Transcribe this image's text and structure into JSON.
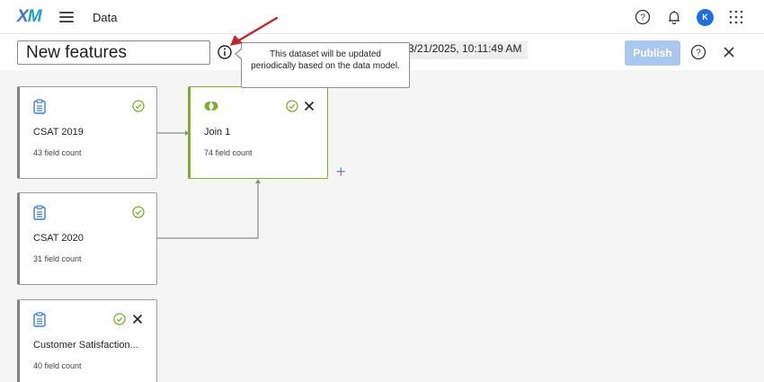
{
  "topbar": {
    "logo": "XM",
    "app_title": "Data",
    "avatar_initial": "K",
    "icons": [
      "hamburger-icon",
      "help-icon",
      "bell-icon",
      "apps-grid-icon"
    ]
  },
  "header": {
    "dataset_name": "New features",
    "timestamp": "3/21/2025, 10:11:49 AM",
    "publish_label": "Publish"
  },
  "tooltip": {
    "text": "This dataset will be updated periodically based on the data model."
  },
  "cards": [
    {
      "title": "CSAT 2019",
      "subtitle": "43 field count",
      "type": "source"
    },
    {
      "title": "Join 1",
      "subtitle": "74 field count",
      "type": "join"
    },
    {
      "title": "CSAT 2020",
      "subtitle": "31 field count",
      "type": "source"
    },
    {
      "title": "Customer Satisfaction...",
      "subtitle": "40 field count",
      "type": "source"
    }
  ],
  "colors": {
    "logo_x": "#3b6fd6",
    "logo_m": "#17a3c8",
    "accent_blue": "#1f6fe0",
    "publish_disabled": "#a9c8ef",
    "join_green": "#7fae2c",
    "arrow_red": "#c0262d"
  }
}
